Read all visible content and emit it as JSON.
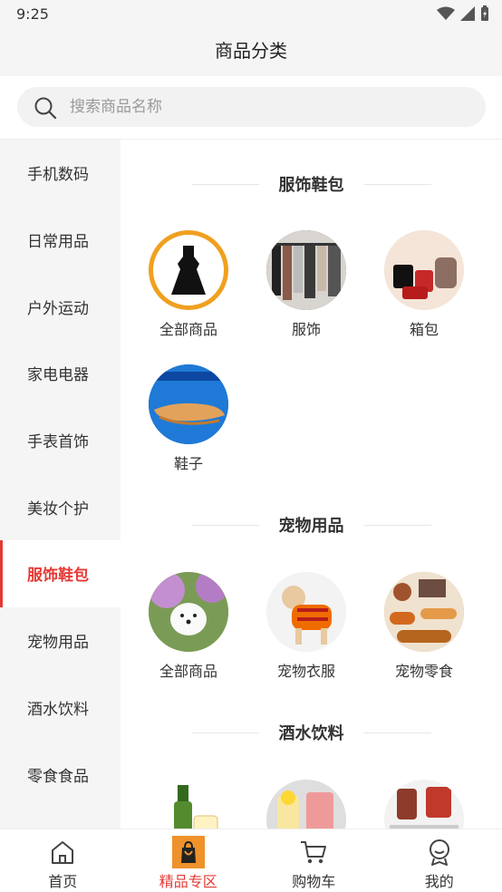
{
  "status": {
    "time": "9:25"
  },
  "header": {
    "title": "商品分类"
  },
  "search": {
    "placeholder": "搜索商品名称"
  },
  "sidebar": {
    "items": [
      {
        "label": "手机数码"
      },
      {
        "label": "日常用品"
      },
      {
        "label": "户外运动"
      },
      {
        "label": "家电电器"
      },
      {
        "label": "手表首饰"
      },
      {
        "label": "美妆个护"
      },
      {
        "label": "服饰鞋包",
        "active": true
      },
      {
        "label": "宠物用品"
      },
      {
        "label": "酒水饮料"
      },
      {
        "label": "零食食品"
      }
    ]
  },
  "sections": [
    {
      "title": "服饰鞋包",
      "items": [
        {
          "label": "全部商品"
        },
        {
          "label": "服饰"
        },
        {
          "label": "箱包"
        },
        {
          "label": "鞋子"
        }
      ]
    },
    {
      "title": "宠物用品",
      "items": [
        {
          "label": "全部商品"
        },
        {
          "label": "宠物衣服"
        },
        {
          "label": "宠物零食"
        }
      ]
    },
    {
      "title": "酒水饮料",
      "items": []
    }
  ],
  "tabbar": {
    "items": [
      {
        "label": "首页",
        "icon": "home-icon"
      },
      {
        "label": "精品专区",
        "icon": "shopping-bag-icon",
        "active": true
      },
      {
        "label": "购物车",
        "icon": "cart-icon"
      },
      {
        "label": "我的",
        "icon": "profile-icon"
      }
    ]
  },
  "colors": {
    "accent": "#e53935",
    "bag_icon": "#f0922b"
  }
}
